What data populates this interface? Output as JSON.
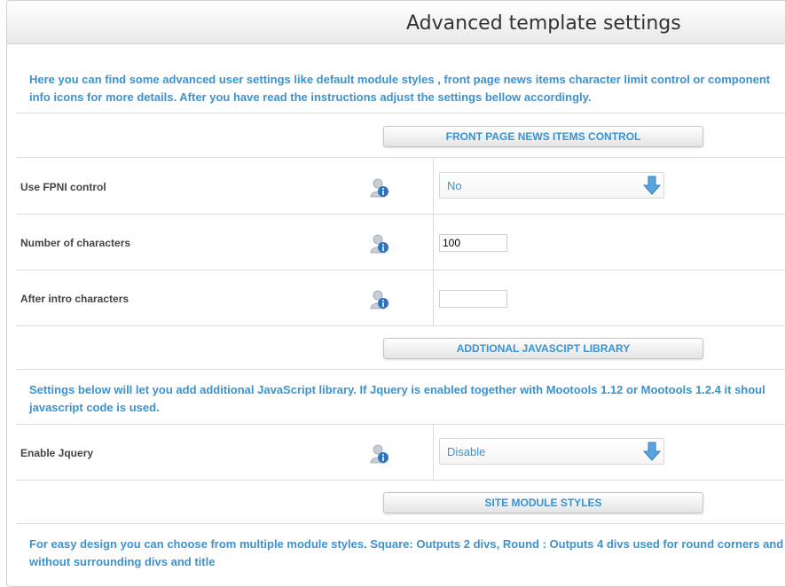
{
  "page": {
    "title": "Advanced template settings",
    "intro": [
      "Here you can find some advanced user settings like default module styles , front page news items character limit control or component",
      "info icons for more details. After you have read the instructions adjust the settings bellow accordingly."
    ]
  },
  "sections": {
    "fpni": {
      "button_label": "FRONT PAGE NEWS ITEMS CONTROL",
      "rows": {
        "use_fpni": {
          "label": "Use FPNI control",
          "value": "No"
        },
        "num_chars": {
          "label": "Number of characters",
          "value": "100"
        },
        "after_intro": {
          "label": "After intro characters",
          "value": ""
        }
      }
    },
    "js_library": {
      "button_label": "ADDTIONAL JAVASCIPT LIBRARY",
      "desc": [
        "Settings below will let you add additional JavaScript library. If Jquery is enabled together with Mootools 1.12 or Mootools 1.2.4 it shoul",
        "javascript code is used."
      ],
      "rows": {
        "jquery": {
          "label": "Enable Jquery",
          "value": "Disable"
        }
      }
    },
    "module_styles": {
      "button_label": "SITE MODULE STYLES",
      "desc": [
        "For easy design you can choose from multiple module styles. Square: Outputs 2 divs, Round : Outputs 4 divs used for round corners and",
        "without surrounding divs and title"
      ]
    }
  },
  "colors": {
    "accent": "#3a93d0",
    "label": "#444444",
    "border": "#dcdcdc"
  },
  "icons": {
    "info": "user-info-icon",
    "dropdown": "blue-down-arrow-icon"
  }
}
